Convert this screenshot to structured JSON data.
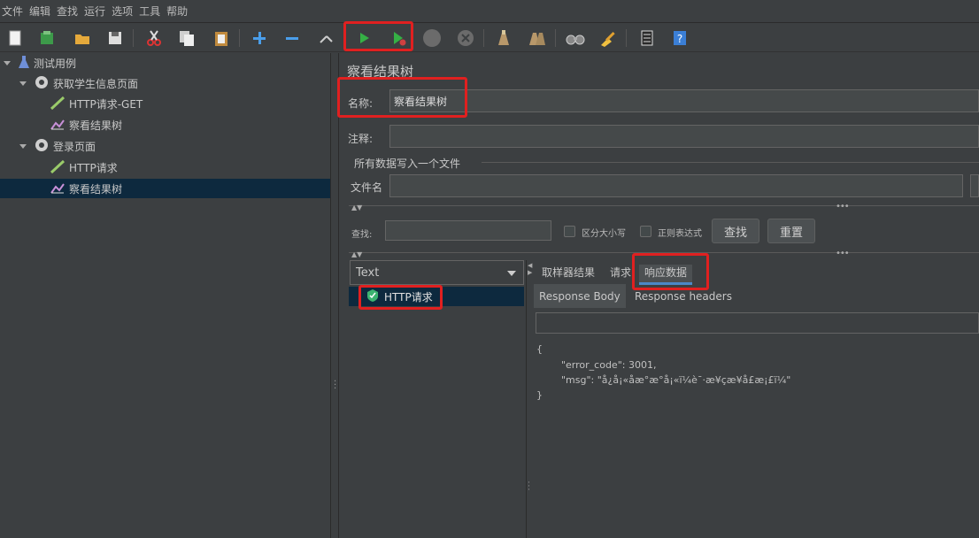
{
  "menu": [
    "文件",
    "编辑",
    "查找",
    "运行",
    "选项",
    "工具",
    "帮助"
  ],
  "toolbar_icons": [
    "new-icon",
    "templates-icon",
    "open-icon",
    "save-icon",
    "cut-icon",
    "copy-icon",
    "paste-icon",
    "expand-icon",
    "collapse-icon",
    "toggle-icon",
    "start-icon",
    "start-no-pauses-icon",
    "stop-icon",
    "shutdown-icon",
    "clear-icon",
    "clear-all-icon",
    "search-icon",
    "reset-search-icon",
    "function-helper-icon",
    "help-icon"
  ],
  "tree": [
    {
      "label": "测试用例",
      "icon": "test-plan-icon",
      "level": 0,
      "expanded": true
    },
    {
      "label": "获取学生信息页面",
      "icon": "thread-group-icon",
      "level": 1,
      "expanded": true
    },
    {
      "label": "HTTP请求-GET",
      "icon": "sampler-icon",
      "level": 2
    },
    {
      "label": "察看结果树",
      "icon": "listener-icon",
      "level": 2
    },
    {
      "label": "登录页面",
      "icon": "thread-group-icon",
      "level": 1,
      "expanded": true
    },
    {
      "label": "HTTP请求",
      "icon": "sampler-icon",
      "level": 2
    },
    {
      "label": "察看结果树",
      "icon": "listener-icon",
      "level": 2,
      "selected": true
    }
  ],
  "panel": {
    "title": "察看结果树",
    "name_label": "名称:",
    "name_value": "察看结果树",
    "comment_label": "注释:",
    "comment_value": "",
    "file_group_title": "所有数据写入一个文件",
    "filename_label": "文件名",
    "filename_value": ""
  },
  "search": {
    "label": "查找:",
    "value": "",
    "case_sensitive_label": "区分大小写",
    "case_sensitive_checked": false,
    "regex_label": "正则表达式",
    "regex_checked": false,
    "find_button": "查找",
    "reset_button": "重置"
  },
  "renderer": {
    "selected": "Text"
  },
  "results": [
    {
      "label": "HTTP请求",
      "status": "success"
    }
  ],
  "tabs": [
    "取样器结果",
    "请求",
    "响应数据"
  ],
  "active_tab": "响应数据",
  "subtabs": [
    "Response Body",
    "Response headers"
  ],
  "active_subtab": "Response Body",
  "response_lines": [
    "{",
    "        \"error_code\": 3001,",
    "        \"msg\": \"å¿å¡«åæ°æ°å¡«ï¼è¯·æ¥çæ¥å£æ¡£ï¼\"",
    "}"
  ],
  "colors": {
    "background": "#3c3f41",
    "selection": "#0d293e",
    "highlight": "#e02020",
    "tab_underline": "#4a88c7",
    "success_green": "#3cb371"
  }
}
